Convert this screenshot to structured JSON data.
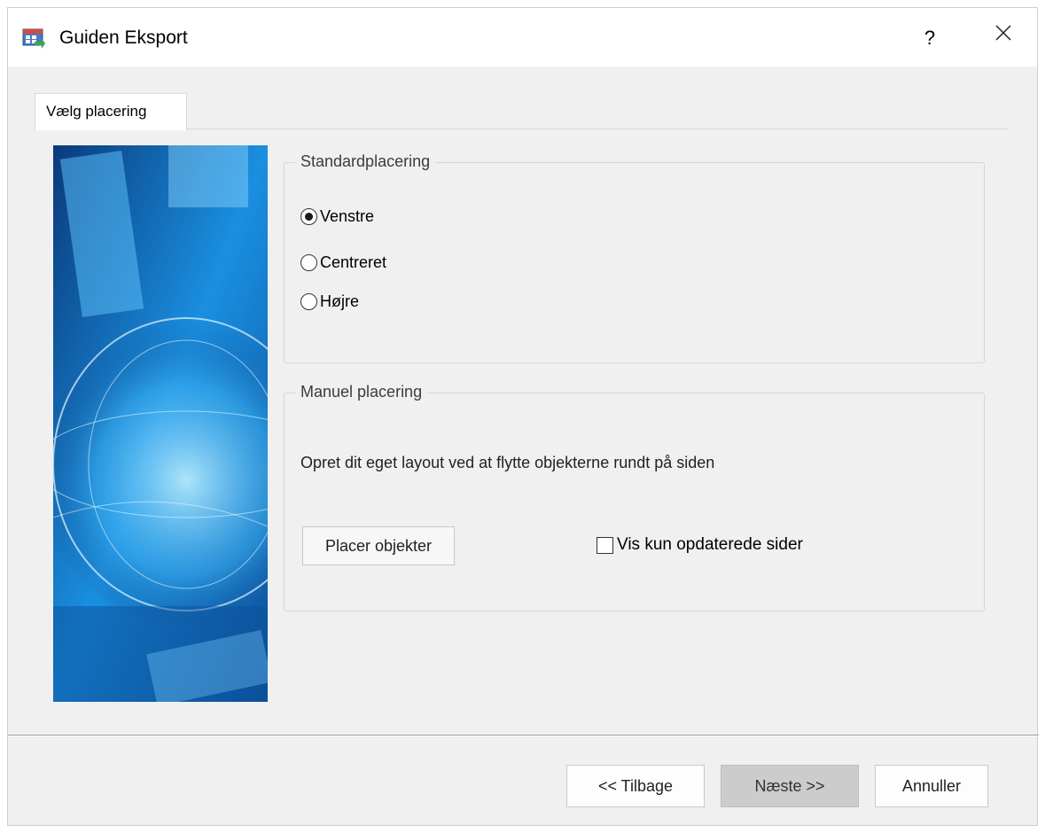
{
  "window": {
    "title": "Guiden Eksport",
    "help_label": "?",
    "close_icon": "close-icon"
  },
  "tabs": [
    {
      "label": "Vælg placering",
      "active": true
    }
  ],
  "standard_group": {
    "legend": "Standardplacering",
    "options": [
      {
        "label": "Venstre",
        "checked": true
      },
      {
        "label": "Centreret",
        "checked": false
      },
      {
        "label": "Højre",
        "checked": false
      }
    ]
  },
  "manual_group": {
    "legend": "Manuel placering",
    "description": "Opret dit eget layout ved at flytte objekterne rundt på siden",
    "place_button": "Placer objekter",
    "checkbox_label": "Vis kun opdaterede sider",
    "checkbox_checked": false
  },
  "footer": {
    "back_label": "<< Tilbage",
    "next_label": "Næste >>",
    "cancel_label": "Annuller"
  },
  "colors": {
    "dialog_bg": "#f0f0f0",
    "banner_blue": "#1a8fe0"
  }
}
